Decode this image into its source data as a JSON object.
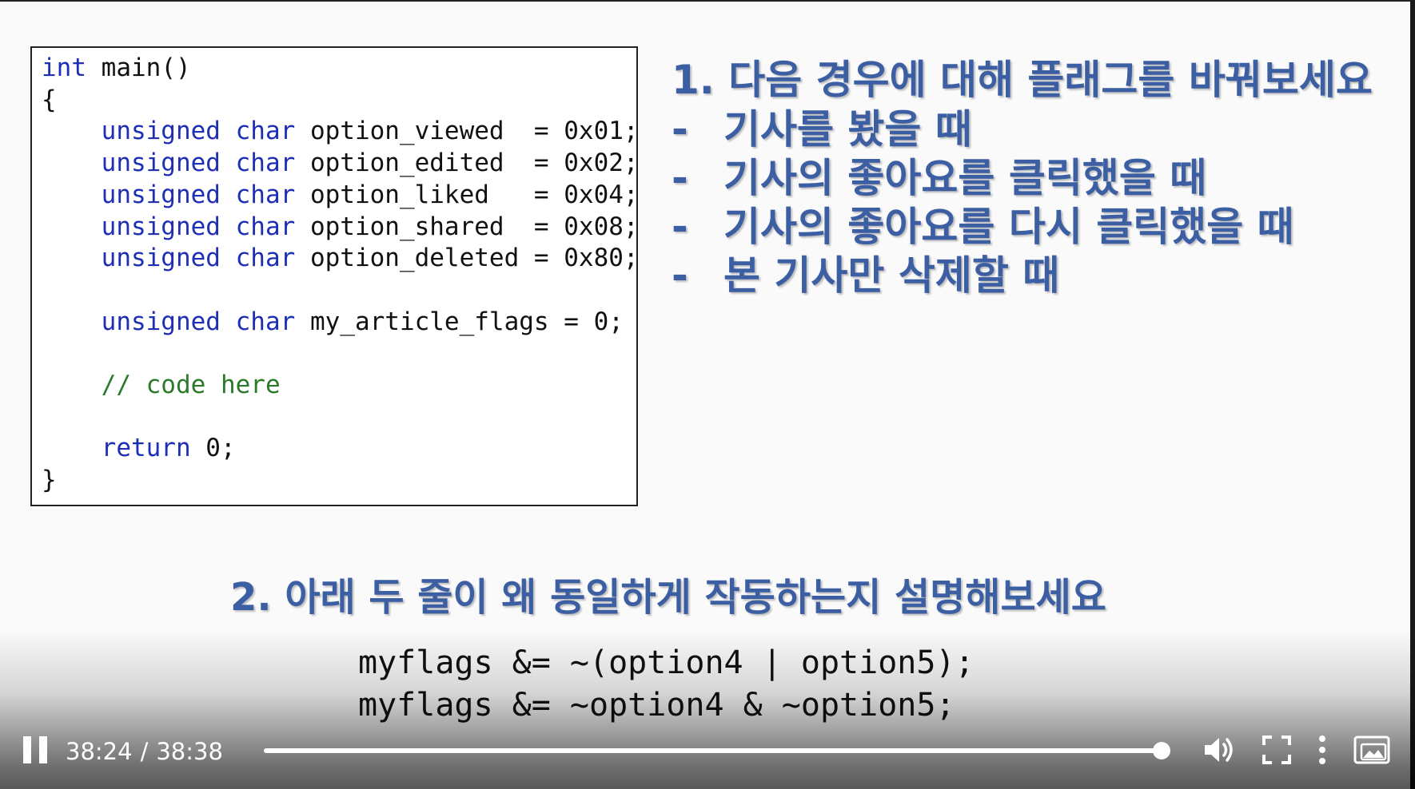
{
  "slide": {
    "code_lines": [
      {
        "kw": "int",
        "rest": " main()",
        "indent": ""
      },
      {
        "kw": "",
        "rest": "{",
        "indent": ""
      },
      {
        "kw": "unsigned char",
        "rest": " option_viewed  = 0x01;",
        "indent": "    "
      },
      {
        "kw": "unsigned char",
        "rest": " option_edited  = 0x02;",
        "indent": "    "
      },
      {
        "kw": "unsigned char",
        "rest": " option_liked   = 0x04;",
        "indent": "    "
      },
      {
        "kw": "unsigned char",
        "rest": " option_shared  = 0x08;",
        "indent": "    "
      },
      {
        "kw": "unsigned char",
        "rest": " option_deleted = 0x80;",
        "indent": "    "
      },
      {
        "kw": "",
        "rest": "",
        "indent": ""
      },
      {
        "kw": "unsigned char",
        "rest": " my_article_flags = 0;",
        "indent": "    "
      },
      {
        "kw": "",
        "rest": "",
        "indent": ""
      },
      {
        "comment": "// code here",
        "indent": "    "
      },
      {
        "kw": "",
        "rest": "",
        "indent": ""
      },
      {
        "kw": "return",
        "rest": " 0;",
        "indent": "    "
      },
      {
        "kw": "",
        "rest": "}",
        "indent": ""
      }
    ],
    "question1": {
      "title": "1. 다음 경우에 대해 플래그를 바꿔보세요",
      "dash": "-",
      "items": [
        "기사를 봤을 때",
        "기사의 좋아요를 클릭했을 때",
        "기사의 좋아요를 다시 클릭했을 때",
        "본 기사만 삭제할 때"
      ]
    },
    "question2": {
      "title": "2. 아래 두 줄이 왜 동일하게 작동하는지 설명해보세요",
      "code": [
        "myflags &= ~(option4 | option5);",
        "myflags &= ~option4 & ~option5;"
      ]
    }
  },
  "player": {
    "current_time": "38:24",
    "separator": "/",
    "duration": "38:38",
    "progress": 0.994,
    "icons": {
      "pause": "pause-icon",
      "volume": "volume-icon",
      "fullscreen": "fullscreen-icon",
      "more": "more-vertical-icon",
      "pip": "picture-in-picture-icon"
    }
  }
}
